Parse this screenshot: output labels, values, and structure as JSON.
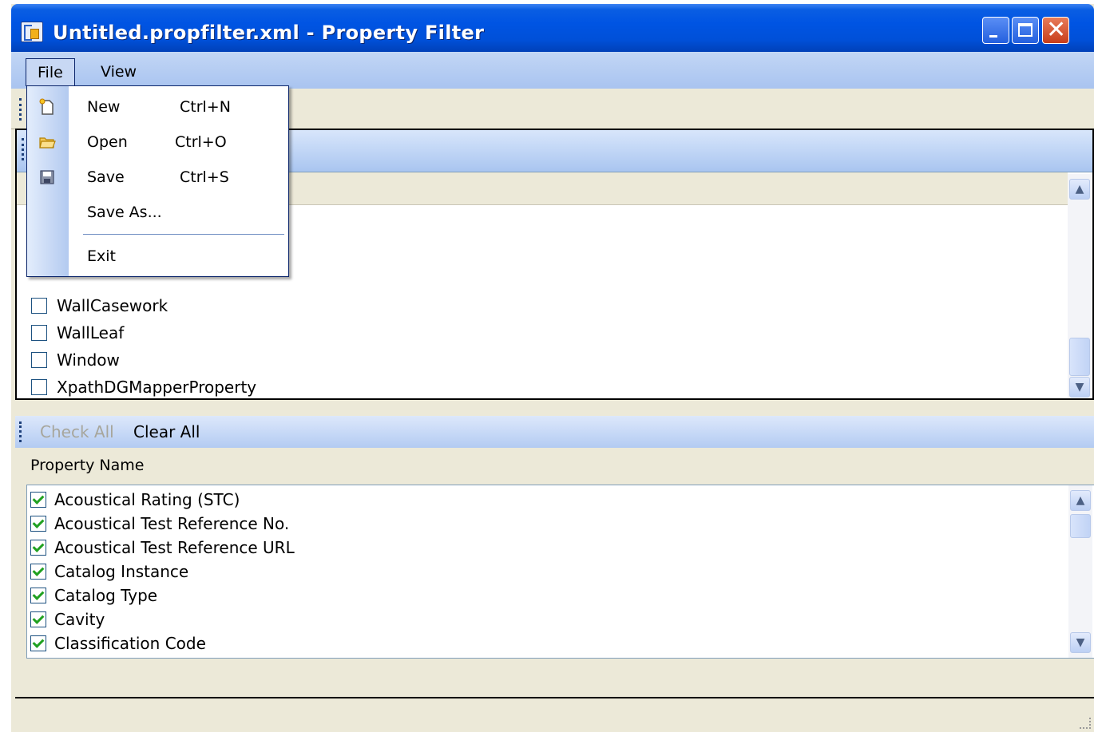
{
  "window": {
    "title": "Untitled.propfilter.xml - Property Filter",
    "icon": "bentley-app-icon",
    "controls": [
      "minimize-icon",
      "maximize-icon",
      "close-icon"
    ]
  },
  "menubar": {
    "items": [
      {
        "label": "File",
        "open": true
      },
      {
        "label": "View"
      }
    ]
  },
  "file_menu": {
    "items": [
      {
        "label": "New",
        "shortcut": "Ctrl+N",
        "icon": "new-document-icon"
      },
      {
        "label": "Open",
        "shortcut": "Ctrl+O",
        "icon": "open-folder-icon"
      },
      {
        "label": "Save",
        "shortcut": "Ctrl+S",
        "icon": "save-disk-icon"
      },
      {
        "label": "Save As...",
        "shortcut": ""
      },
      {
        "label": "Exit",
        "shortcut": ""
      }
    ]
  },
  "class_list": {
    "items": [
      {
        "label": "WallCasework",
        "checked": false
      },
      {
        "label": "WallLeaf",
        "checked": false
      },
      {
        "label": "Window",
        "checked": false
      },
      {
        "label": "XpathDGMapperProperty",
        "checked": false
      }
    ]
  },
  "property_toolbar": {
    "check_all": "Check All",
    "check_all_enabled": false,
    "clear_all": "Clear All"
  },
  "property_list": {
    "header": "Property Name",
    "items": [
      {
        "label": "Acoustical Rating (STC)",
        "checked": true
      },
      {
        "label": "Acoustical Test Reference No.",
        "checked": true
      },
      {
        "label": "Acoustical Test Reference URL",
        "checked": true
      },
      {
        "label": "Catalog Instance",
        "checked": true
      },
      {
        "label": "Catalog Type",
        "checked": true
      },
      {
        "label": "Cavity",
        "checked": true
      },
      {
        "label": "Classification Code",
        "checked": true
      }
    ]
  },
  "colors": {
    "titlebar": "#0054e3",
    "menubar": "#a9c4f0",
    "check": "#21a121",
    "window_bg": "#ece9d8"
  }
}
